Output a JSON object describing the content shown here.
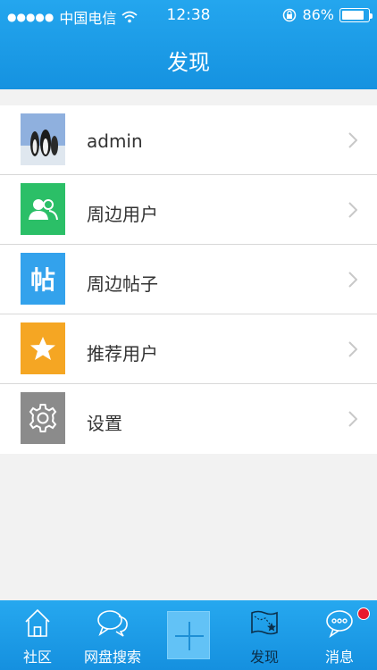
{
  "status_bar": {
    "signal": "●●●●●",
    "carrier": "中国电信",
    "time": "12:38",
    "battery_pct": "86%",
    "wifi_icon": "wifi-icon",
    "lock_icon": "orientation-lock-icon"
  },
  "header": {
    "title": "发现"
  },
  "menu": {
    "items": [
      {
        "label": "admin",
        "icon": "avatar"
      },
      {
        "label": "周边用户",
        "icon": "users-icon",
        "color": "#2bbf67"
      },
      {
        "label": "周边帖子",
        "icon": "post-icon",
        "color": "#33a2ec",
        "icon_text": "帖"
      },
      {
        "label": "推荐用户",
        "icon": "star-icon",
        "color": "#f5a623"
      },
      {
        "label": "设置",
        "icon": "gear-icon",
        "color": "#8b8b8b"
      }
    ]
  },
  "tabbar": {
    "tabs": [
      {
        "label": "社区",
        "icon": "home-icon"
      },
      {
        "label": "网盘搜索",
        "icon": "chat-bubbles-icon"
      },
      {
        "label": "",
        "icon": "plus-icon"
      },
      {
        "label": "发现",
        "icon": "map-icon",
        "active": true
      },
      {
        "label": "消息",
        "icon": "message-icon",
        "badge": true
      }
    ]
  }
}
